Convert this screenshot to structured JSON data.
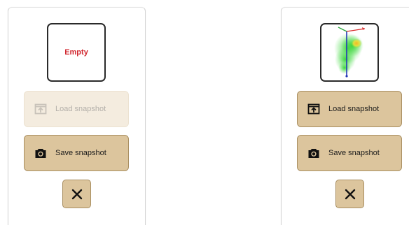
{
  "left_panel": {
    "thumbnail": {
      "state": "empty",
      "text": "Empty",
      "text_color": "#d1272f"
    },
    "load_button": {
      "label": "Load snapshot",
      "enabled": false,
      "icon": "load-snapshot-icon"
    },
    "save_button": {
      "label": "Save snapshot",
      "enabled": true,
      "icon": "camera-icon"
    },
    "close_button": {
      "icon": "close-icon"
    }
  },
  "right_panel": {
    "thumbnail": {
      "state": "filled",
      "icon": "snapshot-preview-heatmap"
    },
    "load_button": {
      "label": "Load snapshot",
      "enabled": true,
      "icon": "load-snapshot-icon"
    },
    "save_button": {
      "label": "Save snapshot",
      "enabled": true,
      "icon": "camera-icon"
    },
    "close_button": {
      "icon": "close-icon"
    }
  },
  "colors": {
    "button_fill": "#dcc59d",
    "button_border": "#a98f61",
    "button_disabled_fill": "#f4ecdf",
    "empty_text": "#d1272f"
  }
}
